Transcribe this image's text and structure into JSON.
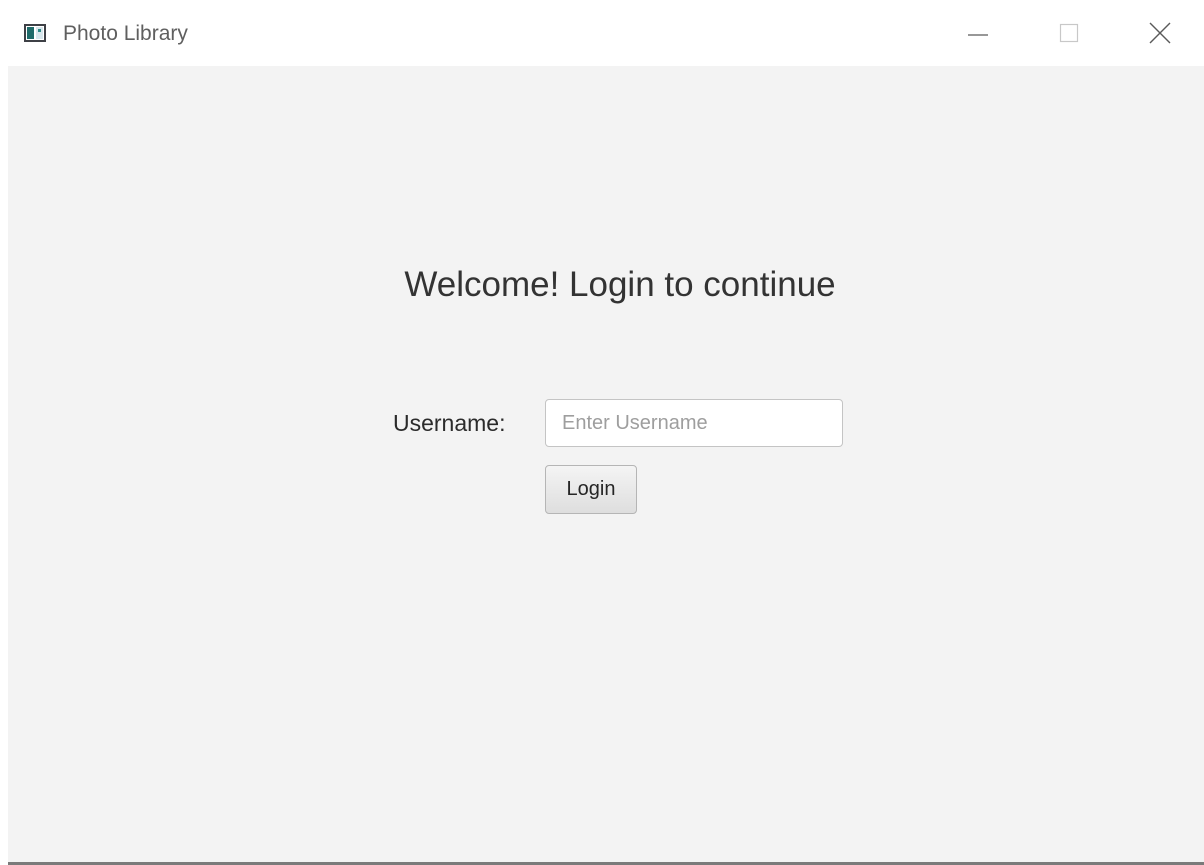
{
  "window": {
    "title": "Photo Library",
    "icon": "app-window-icon",
    "controls": [
      "minimize-icon",
      "maximize-icon",
      "close-icon"
    ]
  },
  "login": {
    "heading": "Welcome! Login to continue",
    "username_label": "Username:",
    "username_placeholder": "Enter Username",
    "username_value": "",
    "login_button": "Login"
  },
  "colors": {
    "content_background": "#f3f3f3",
    "titlebar_background": "#ffffff",
    "text": "#333333"
  }
}
